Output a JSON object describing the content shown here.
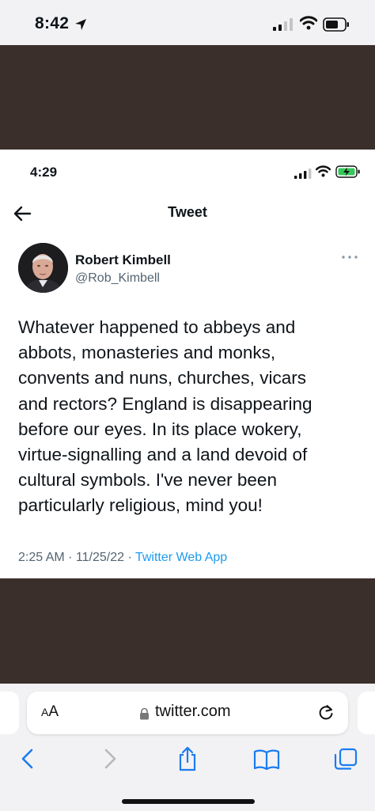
{
  "outer_status_bar": {
    "time": "8:42",
    "icons": [
      "location-arrow-icon",
      "cellular-signal-icon",
      "wifi-icon",
      "battery-icon"
    ]
  },
  "tweet_screenshot": {
    "status_bar": {
      "time": "4:29",
      "icons": [
        "cellular-signal-icon",
        "wifi-icon",
        "battery-charging-icon"
      ]
    },
    "header": {
      "title": "Tweet",
      "back_icon": "arrow-left-icon"
    },
    "author": {
      "name": "Robert Kimbell",
      "handle": "@Rob_Kimbell",
      "more_icon": "more-dots-icon"
    },
    "text": "Whatever happened to abbeys and\nabbots, monasteries and monks,\nconvents and nuns, churches, vicars\nand rectors? England is disappearing\nbefore our eyes. In its place wokery,\nvirtue-signalling and a land devoid of\ncultural symbols. I've never been\nparticularly religious, mind you!",
    "meta": {
      "time": "2:25 AM",
      "separator": " · ",
      "date": "11/25/22",
      "source": "Twitter Web App"
    }
  },
  "safari": {
    "aa_label": "AA",
    "url": "twitter.com",
    "toolbar": [
      "chevron-left-icon",
      "chevron-right-icon",
      "share-icon",
      "book-icon",
      "tabs-icon"
    ]
  },
  "colors": {
    "background_band": "#3b2f2c",
    "link": "#1d9bf0",
    "secondary_text": "#536471",
    "safari_blue": "#1a7cf0"
  }
}
